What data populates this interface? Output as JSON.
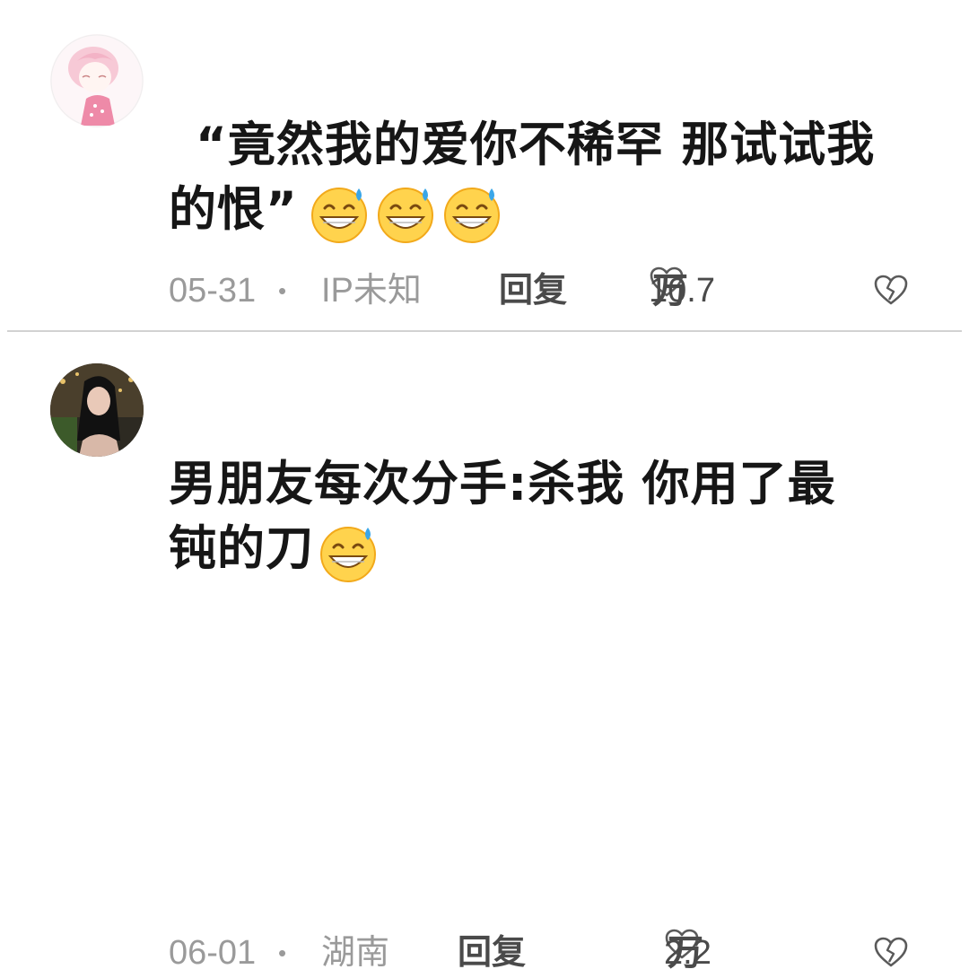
{
  "comments": [
    {
      "avatar": "avatar-pink-anime-girl",
      "text_line1": "“竟然我的爱你不稀罕 那试试我",
      "text_line2": "的恨”",
      "emojis": [
        "grin-sweat-emoji",
        "grin-sweat-emoji",
        "grin-sweat-emoji"
      ],
      "date": "05-31",
      "separator": "•",
      "location": "IP未知",
      "reply_label": "回复",
      "likes_number": "10.7",
      "likes_unit": "万"
    },
    {
      "avatar": "avatar-dark-hair-girl",
      "text_line1": "男朋友每次分手:杀我 你用了最",
      "text_line2": "钝的刀",
      "emojis": [
        "grin-sweat-emoji"
      ],
      "date": "06-01",
      "separator": "•",
      "location": "湖南",
      "reply_label": "回复",
      "likes_number": "2.2",
      "likes_unit": "万"
    }
  ],
  "colors": {
    "text": "#161616",
    "meta": "#9a9a9a",
    "action": "#4a4a4a",
    "divider": "#d2d2d2"
  }
}
